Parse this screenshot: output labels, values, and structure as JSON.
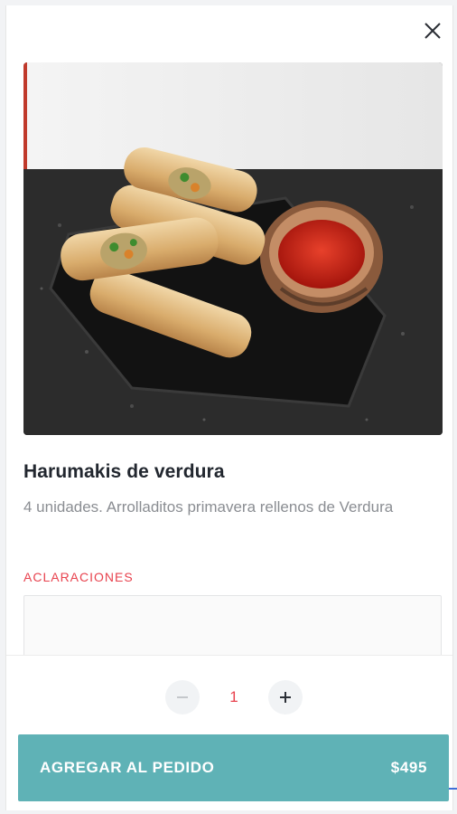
{
  "product": {
    "name": "Harumakis de verdura",
    "description": "4 unidades. Arrolladitos primavera rellenos de Verdura",
    "image_alt": "Harumakis de verdura"
  },
  "notes": {
    "label": "ACLARACIONES",
    "value": "",
    "placeholder": ""
  },
  "quantity": {
    "value": "1",
    "decrement_icon": "minus-icon",
    "increment_icon": "plus-icon"
  },
  "cart_button": {
    "label": "AGREGAR AL PEDIDO",
    "price": "$495"
  },
  "icons": {
    "close": "close-icon"
  },
  "colors": {
    "accent": "#e8424e",
    "button": "#5fb2b6",
    "title": "#22272f",
    "description": "#8a8d92"
  }
}
